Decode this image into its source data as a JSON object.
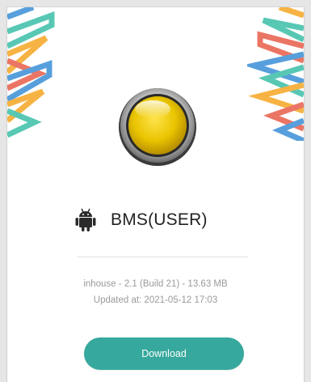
{
  "app": {
    "name": "BMS(USER)",
    "version_info": "inhouse - 2.1 (Build 21) - 13.63 MB",
    "updated_at": "Updated at: 2021-05-12 17:03"
  },
  "actions": {
    "download_label": "Download"
  },
  "icons": {
    "app_icon": "yellow-button-icon",
    "platform_icon": "android-icon"
  },
  "colors": {
    "accent": "#36a89d",
    "app_icon_yellow": "#e9c400",
    "deco_blue": "#3a8fd6",
    "deco_orange": "#f5a623",
    "deco_red": "#e85d4a",
    "deco_teal": "#3cbfa8"
  }
}
